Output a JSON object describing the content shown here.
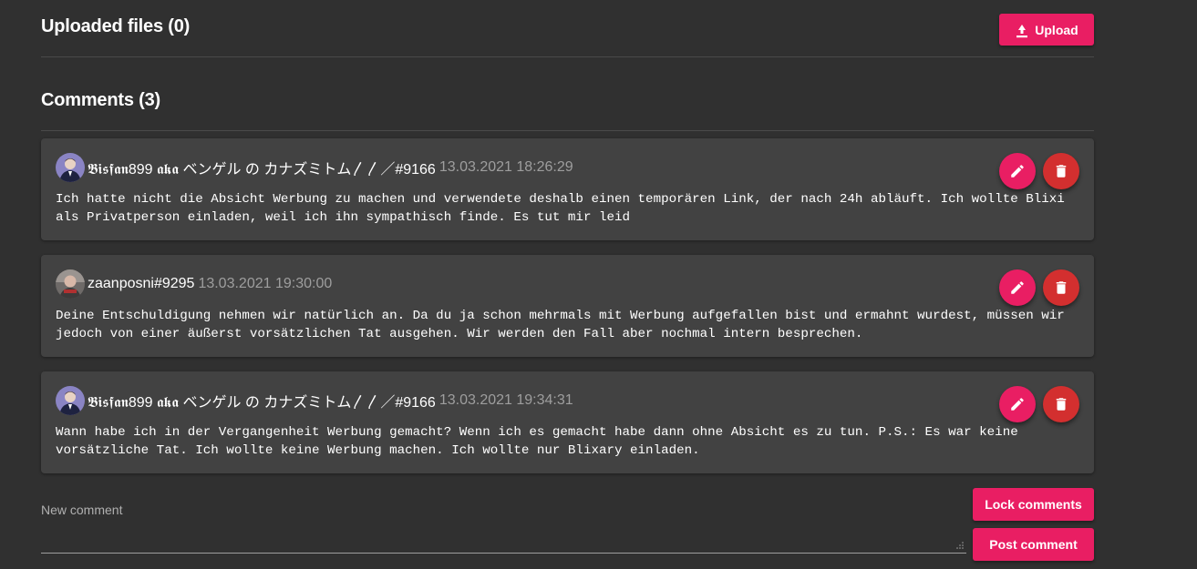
{
  "files": {
    "title": "Uploaded files (0)",
    "upload_label": "Upload"
  },
  "comments": {
    "title": "Comments (3)",
    "items": [
      {
        "author": "𝕭𝖎𝖘𝖋𝖆𝖓899 𝖆𝖐𝖆 ベンゲル の カナズミトム〳〳／#9166",
        "timestamp": "13.03.2021 18:26:29",
        "text": "Ich hatte nicht die Absicht Werbung zu machen und verwendete deshalb einen temporären Link, der nach 24h abläuft. Ich wollte Blixi als Privatperson einladen, weil ich ihn sympathisch finde. Es tut mir leid"
      },
      {
        "author": "zaanposni#9295",
        "timestamp": "13.03.2021 19:30:00",
        "text": "Deine Entschuldigung nehmen wir natürlich an. Da du ja schon mehrmals mit Werbung aufgefallen bist und ermahnt wurdest, müssen wir jedoch von einer äußerst vorsätzlichen Tat ausgehen. Wir werden den Fall aber nochmal intern besprechen."
      },
      {
        "author": "𝕭𝖎𝖘𝖋𝖆𝖓899 𝖆𝖐𝖆 ベンゲル の カナズミトム〳〳／#9166",
        "timestamp": "13.03.2021 19:34:31",
        "text": "Wann habe ich in der Vergangenheit Werbung gemacht? Wenn ich es gemacht habe dann ohne Absicht es zu tun. P.S.: Es war keine vorsätzliche Tat. Ich wollte keine Werbung machen. Ich wollte nur Blixary einladen."
      }
    ]
  },
  "composer": {
    "label": "New comment",
    "lock_label": "Lock comments",
    "post_label": "Post comment"
  },
  "colors": {
    "background": "#303030",
    "card": "#424242",
    "accent": "#e91e63",
    "danger": "#d32f2f",
    "muted_text": "#9e9e9e"
  },
  "icons": {
    "upload": "upload-icon",
    "edit": "pencil-icon",
    "delete": "trash-icon",
    "resize": "resize-handle-icon"
  }
}
